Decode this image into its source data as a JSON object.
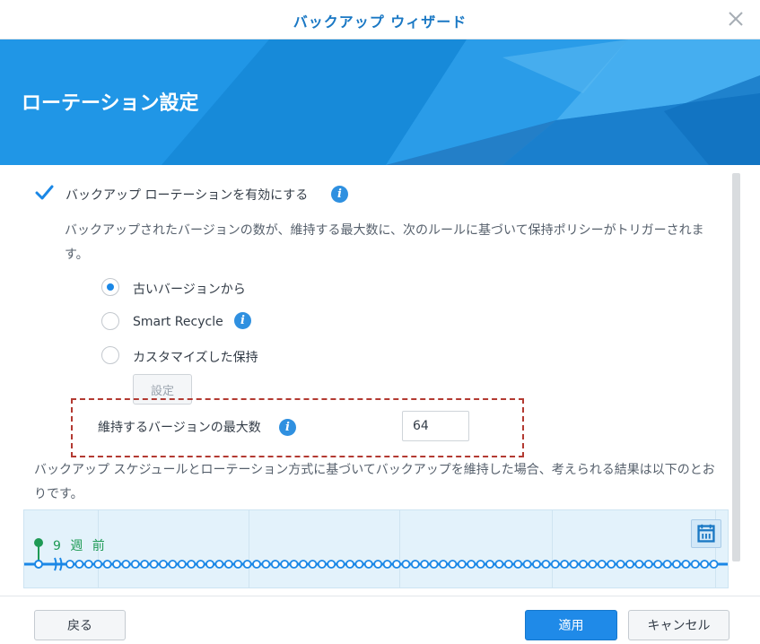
{
  "window": {
    "title": "バックアップ ウィザード"
  },
  "banner": {
    "heading": "ローテーション設定"
  },
  "rotation": {
    "enable_label": "バックアップ ローテーションを有効にする",
    "enabled": true,
    "description": "バックアップされたバージョンの数が、維持する最大数に、次のルールに基づいて保持ポリシーがトリガーされます。",
    "options": [
      {
        "label": "古いバージョンから",
        "selected": true
      },
      {
        "label": "Smart Recycle",
        "selected": false
      },
      {
        "label": "カスタマイズした保持",
        "selected": false
      }
    ],
    "settings_button": "設定",
    "max_versions_label": "維持するバージョンの最大数",
    "max_versions_value": "64"
  },
  "result": {
    "text": "バックアップ スケジュールとローテーション方式に基づいてバックアップを維持した場合、考えられる結果は以下のとおりです。",
    "timeline_label": "9 週 前"
  },
  "footer": {
    "back": "戻る",
    "apply": "適用",
    "cancel": "キャンセル"
  },
  "colors": {
    "accent": "#1f8ae8",
    "title": "#1a78c4",
    "banner": "#1e8fe0",
    "timeline_green": "#1e9a55",
    "highlight_border": "#b33a32"
  },
  "icons": {
    "close": "close-icon",
    "info": "info-icon",
    "checkbox": "checkmark-icon",
    "calendar": "calendar-icon"
  }
}
